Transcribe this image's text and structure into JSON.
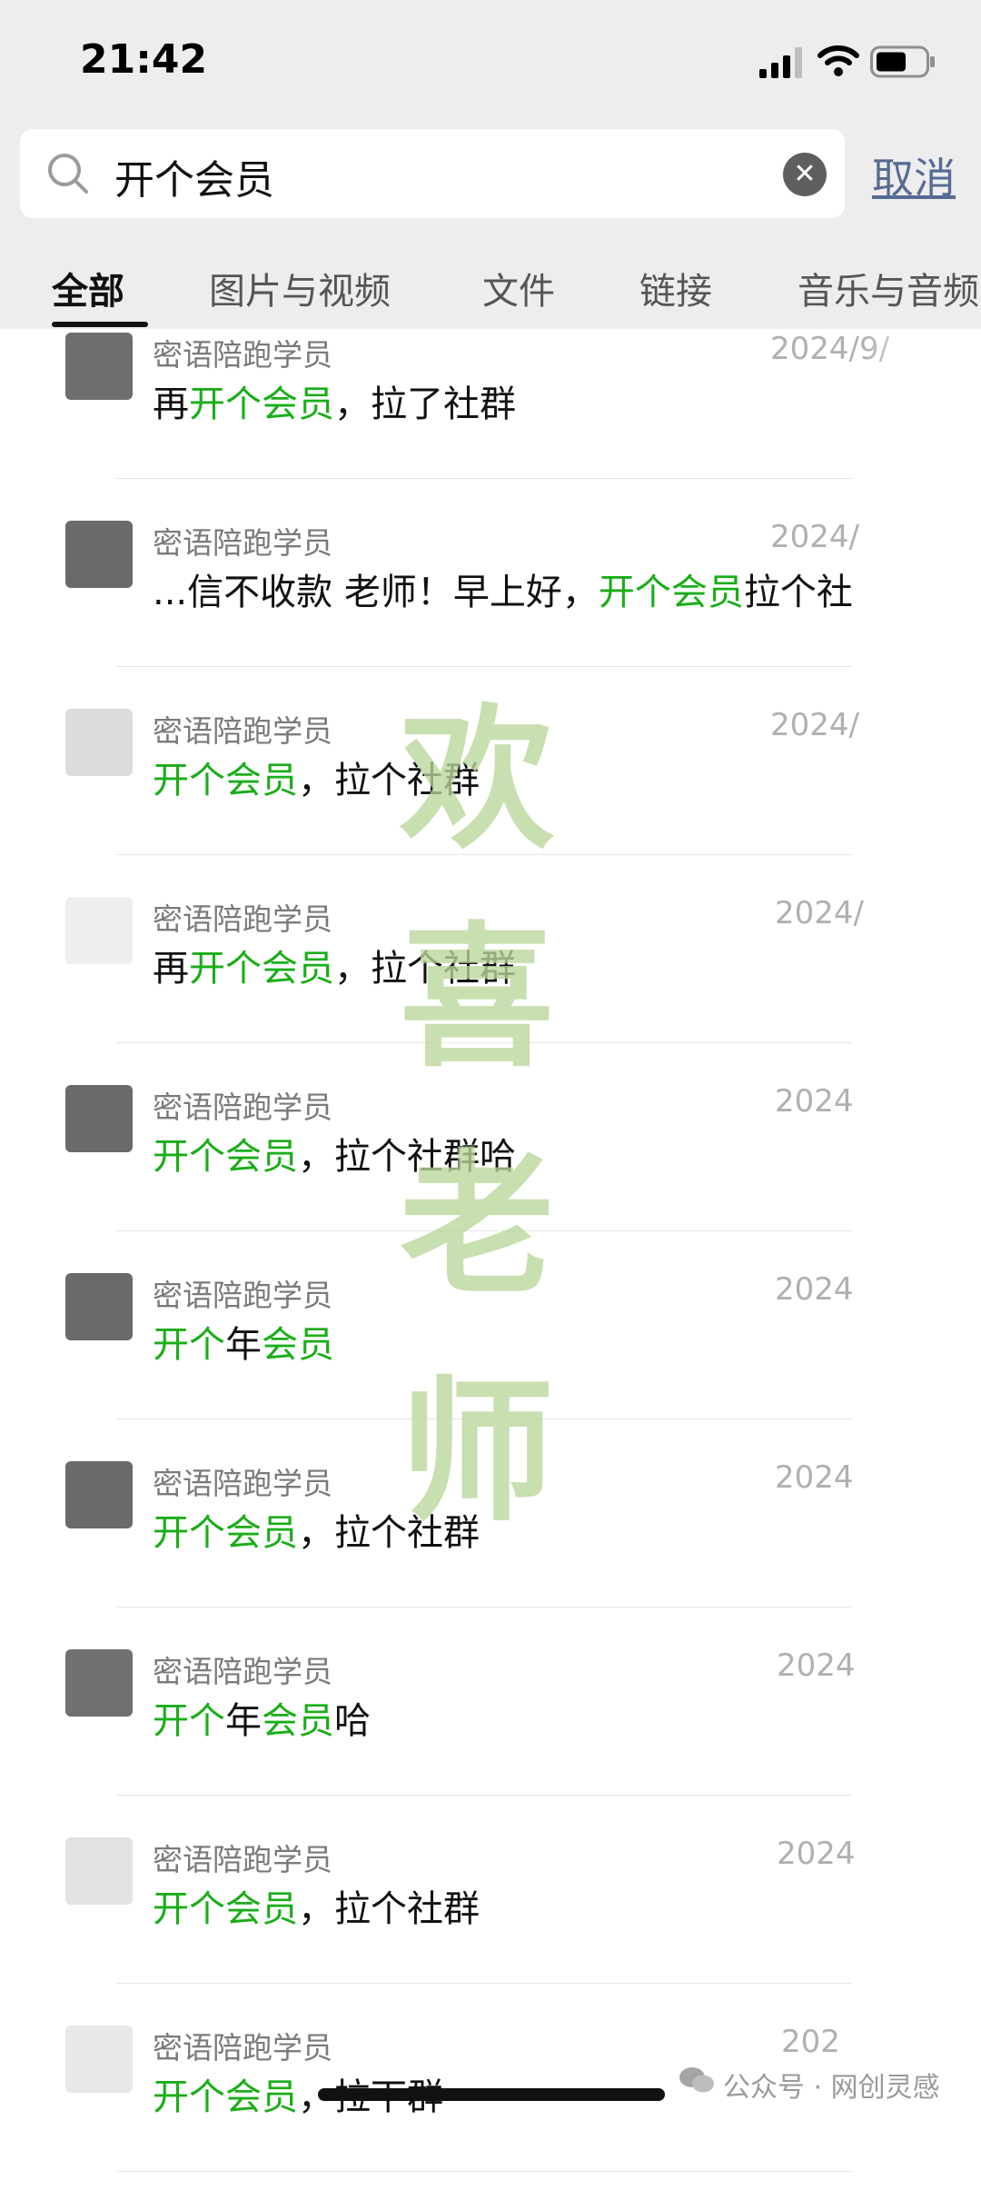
{
  "status": {
    "time": "21:42"
  },
  "search": {
    "query": "开个会员",
    "cancel_label": "取消"
  },
  "tabs": [
    {
      "label": "全部",
      "active": true
    },
    {
      "label": "图片与视频"
    },
    {
      "label": "文件"
    },
    {
      "label": "链接"
    },
    {
      "label": "音乐与音频"
    }
  ],
  "results": [
    {
      "name": "密语陪跑学员",
      "date": "2024/9/",
      "pre": "再",
      "hl": "开个会员",
      "post": "，拉了社群",
      "hl2": "",
      "post2": ""
    },
    {
      "name": "密语陪跑学员",
      "date": "2024/",
      "pre": "...信不收款 老师！早上好，",
      "hl": "开个会员",
      "post": "拉个社",
      "hl2": "",
      "post2": ""
    },
    {
      "name": "密语陪跑学员",
      "date": "2024/",
      "pre": "",
      "hl": "开个会员",
      "post": "，拉个社群",
      "hl2": "",
      "post2": ""
    },
    {
      "name": "密语陪跑学员",
      "date": "2024/",
      "pre": "再",
      "hl": "开个会员",
      "post": "，拉个社群",
      "hl2": "",
      "post2": ""
    },
    {
      "name": "密语陪跑学员",
      "date": "2024",
      "pre": "",
      "hl": "开个会员",
      "post": "，拉个社群哈",
      "hl2": "",
      "post2": ""
    },
    {
      "name": "密语陪跑学员",
      "date": "2024",
      "pre": "",
      "hl": "开个",
      "post": "年",
      "hl2": "会员",
      "post2": ""
    },
    {
      "name": "密语陪跑学员",
      "date": "2024",
      "pre": "",
      "hl": "开个会员",
      "post": "，拉个社群",
      "hl2": "",
      "post2": ""
    },
    {
      "name": "密语陪跑学员",
      "date": "2024",
      "pre": "",
      "hl": "开个",
      "post": "年",
      "hl2": "会员",
      "post2": "哈"
    },
    {
      "name": "密语陪跑学员",
      "date": "2024",
      "pre": "",
      "hl": "开个会员",
      "post": "，拉个社群",
      "hl2": "",
      "post2": ""
    },
    {
      "name": "密语陪跑学员",
      "date": "202",
      "pre": "",
      "hl": "开个会员",
      "post": "，拉下群",
      "hl2": "",
      "post2": ""
    }
  ],
  "avatar_colors": [
    "#6e6e6e",
    "#6a6a6a",
    "#dcdcdc",
    "#eeeeee",
    "#6a6a6a",
    "#6a6a6a",
    "#6a6a6a",
    "#707070",
    "#e2e2e2",
    "#e8e8e8"
  ],
  "watermark": [
    "欢",
    "喜",
    "老",
    "师"
  ],
  "footer": {
    "brand": "公众号 · 网创灵感"
  },
  "colors": {
    "highlight": "#1aad19",
    "cancel": "#566b94",
    "watermark": "#b9d79b"
  }
}
